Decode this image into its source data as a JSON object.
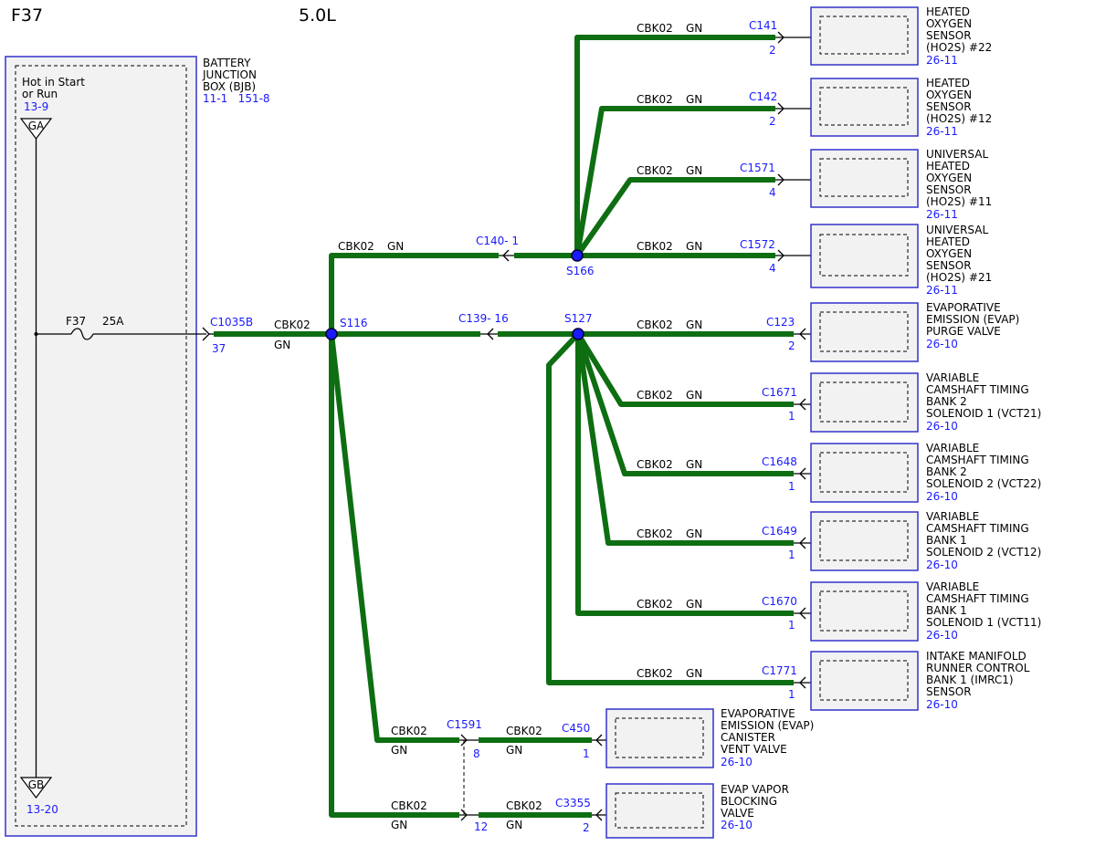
{
  "header": {
    "fuse_id": "F37",
    "engine": "5.0L"
  },
  "bjb": {
    "name_lines": [
      "BATTERY",
      "JUNCTION",
      "BOX (BJB)"
    ],
    "refs": "11-1   151-8",
    "hot_lines": [
      "Hot in Start",
      "or Run"
    ],
    "top_ref": "13-9",
    "top_ground": "GA",
    "bottom_ground": "GB",
    "bottom_ref": "13-20",
    "fuse_name": "F37",
    "fuse_rating": "25A"
  },
  "main_feed": {
    "connector": "C1035B",
    "pin": "37",
    "circuit": "CBK02",
    "color": "GN"
  },
  "splices": {
    "s116": "S116",
    "s166": "S166",
    "s127": "S127"
  },
  "inline_connectors": {
    "c140": "C140- 1",
    "c139": "C139- 16",
    "c1591": "C1591",
    "c1591_pin1": "8",
    "c1591_pin2": "12"
  },
  "branch_labels": {
    "s116_to_s166": {
      "circuit": "CBK02",
      "color": "GN"
    },
    "c1591_in": {
      "circuit": "CBK02",
      "color": "GN"
    },
    "c1591_out": {
      "circuit": "CBK02",
      "color": "GN"
    },
    "c3355_in": {
      "circuit": "CBK02",
      "color": "GN"
    },
    "c3355_out": {
      "circuit": "CBK02",
      "color": "GN"
    }
  },
  "components": [
    {
      "connector": "C141",
      "pin": "2",
      "circuit": "CBK02",
      "color": "GN",
      "lines": [
        "HEATED",
        "OXYGEN",
        "SENSOR",
        "(HO2S) #22"
      ],
      "ref": "26-11"
    },
    {
      "connector": "C142",
      "pin": "2",
      "circuit": "CBK02",
      "color": "GN",
      "lines": [
        "HEATED",
        "OXYGEN",
        "SENSOR",
        "(HO2S) #12"
      ],
      "ref": "26-11"
    },
    {
      "connector": "C1571",
      "pin": "4",
      "circuit": "CBK02",
      "color": "GN",
      "lines": [
        "UNIVERSAL",
        "HEATED",
        "OXYGEN",
        "SENSOR",
        "(HO2S) #11"
      ],
      "ref": "26-11"
    },
    {
      "connector": "C1572",
      "pin": "4",
      "circuit": "CBK02",
      "color": "GN",
      "lines": [
        "UNIVERSAL",
        "HEATED",
        "OXYGEN",
        "SENSOR",
        "(HO2S) #21"
      ],
      "ref": "26-11"
    },
    {
      "connector": "C123",
      "pin": "2",
      "circuit": "CBK02",
      "color": "GN",
      "lines": [
        "EVAPORATIVE",
        "EMISSION (EVAP)",
        "PURGE VALVE"
      ],
      "ref": "26-10"
    },
    {
      "connector": "C1671",
      "pin": "1",
      "circuit": "CBK02",
      "color": "GN",
      "lines": [
        "VARIABLE",
        "CAMSHAFT TIMING",
        "BANK 2",
        "SOLENOID 1 (VCT21)"
      ],
      "ref": "26-10"
    },
    {
      "connector": "C1648",
      "pin": "1",
      "circuit": "CBK02",
      "color": "GN",
      "lines": [
        "VARIABLE",
        "CAMSHAFT TIMING",
        "BANK 2",
        "SOLENOID 2 (VCT22)"
      ],
      "ref": "26-10"
    },
    {
      "connector": "C1649",
      "pin": "1",
      "circuit": "CBK02",
      "color": "GN",
      "lines": [
        "VARIABLE",
        "CAMSHAFT TIMING",
        "BANK 1",
        "SOLENOID 2 (VCT12)"
      ],
      "ref": "26-10"
    },
    {
      "connector": "C1670",
      "pin": "1",
      "circuit": "CBK02",
      "color": "GN",
      "lines": [
        "VARIABLE",
        "CAMSHAFT TIMING",
        "BANK 1",
        "SOLENOID 1 (VCT11)"
      ],
      "ref": "26-10"
    },
    {
      "connector": "C1771",
      "pin": "1",
      "circuit": "CBK02",
      "color": "GN",
      "lines": [
        "INTAKE MANIFOLD",
        "RUNNER CONTROL",
        "BANK 1 (IMRC1)",
        "SENSOR"
      ],
      "ref": "26-10"
    },
    {
      "connector": "C450",
      "pin": "1",
      "lines": [
        "EVAPORATIVE",
        "EMISSION (EVAP)",
        "CANISTER",
        "VENT VALVE"
      ],
      "ref": "26-10"
    },
    {
      "connector": "C3355",
      "pin": "2",
      "lines": [
        "EVAP VAPOR",
        "BLOCKING",
        "VALVE"
      ],
      "ref": "26-10"
    }
  ],
  "colors": {
    "wire": "#0e6e12",
    "reference_text": "#1a1aff",
    "component_border": "#3333cc",
    "component_fill": "#f2f2f2",
    "splice": "#1a1aff"
  }
}
